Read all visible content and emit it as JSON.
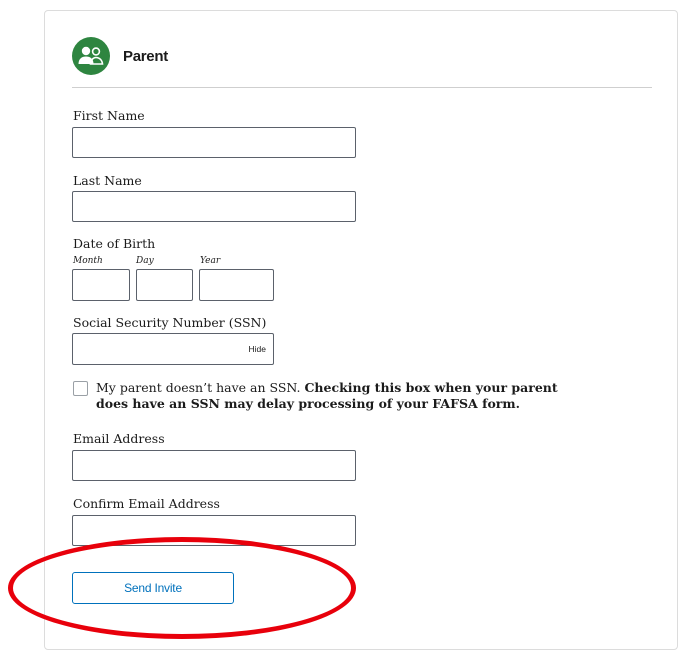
{
  "section": {
    "title": "Parent",
    "icon": "parent-user-icon",
    "icon_color": "#2e8540"
  },
  "fields": {
    "first_name": {
      "label": "First Name",
      "value": ""
    },
    "last_name": {
      "label": "Last Name",
      "value": ""
    },
    "dob": {
      "label": "Date of Birth",
      "month_label": "Month",
      "day_label": "Day",
      "year_label": "Year",
      "month": "",
      "day": "",
      "year": ""
    },
    "ssn": {
      "label": "Social Security Number (SSN)",
      "value": "",
      "toggle_label": "Hide"
    },
    "no_ssn": {
      "checked": false,
      "text": "My parent doesn’t have an SSN.",
      "warning": "Checking this box when your parent does have an SSN may delay processing of your FAFSA form."
    },
    "email": {
      "label": "Email Address",
      "value": ""
    },
    "confirm_email": {
      "label": "Confirm Email Address",
      "value": ""
    }
  },
  "actions": {
    "send_invite_label": "Send Invite",
    "accent_color": "#0071bc"
  },
  "annotation": {
    "highlight_color": "#e8000b"
  }
}
